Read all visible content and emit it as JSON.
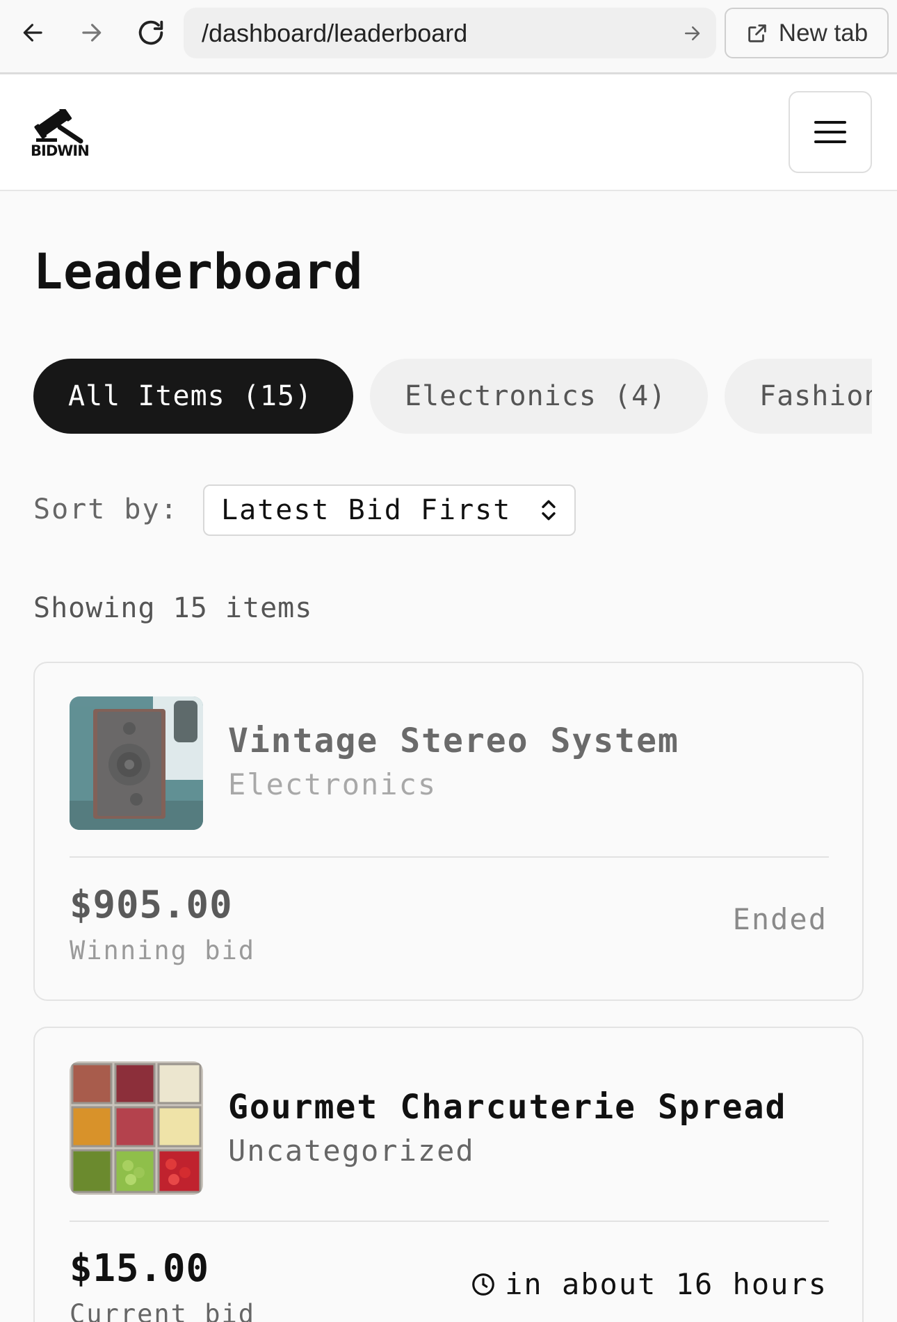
{
  "browser": {
    "url": "/dashboard/leaderboard",
    "new_tab_label": "New tab"
  },
  "header": {
    "logo_text": "BIDWIN"
  },
  "page": {
    "title": "Leaderboard"
  },
  "tabs": [
    {
      "label": "All Items (15)",
      "active": true
    },
    {
      "label": "Electronics (4)",
      "active": false
    },
    {
      "label": "Fashion",
      "active": false
    }
  ],
  "sort": {
    "label": "Sort by:",
    "selected": "Latest Bid First"
  },
  "showing_text": "Showing 15 items",
  "items": [
    {
      "name": "Vintage Stereo System",
      "category": "Electronics",
      "price": "$905.00",
      "bid_label": "Winning bid",
      "status": "Ended"
    },
    {
      "name": "Gourmet Charcuterie Spread",
      "category": "Uncategorized",
      "price": "$15.00",
      "bid_label": "Current bid",
      "status": "in about 16 hours"
    }
  ]
}
